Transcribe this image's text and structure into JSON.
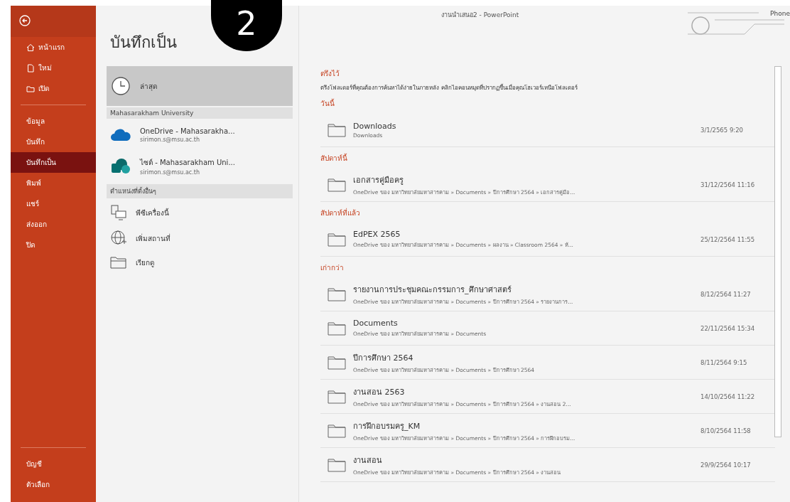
{
  "window": {
    "title": "งานนำเสนอ2 - PowerPoint",
    "user": "Phone"
  },
  "annotation": {
    "label": "2"
  },
  "sidebar": {
    "items": [
      {
        "label": "หน้าแรก",
        "kind": "home",
        "selected": false
      },
      {
        "label": "ใหม่",
        "kind": "new",
        "selected": false
      },
      {
        "label": "เปิด",
        "kind": "open",
        "selected": false
      },
      {
        "label": "ข้อมูล",
        "kind": "plain",
        "selected": false
      },
      {
        "label": "บันทึก",
        "kind": "plain",
        "selected": false
      },
      {
        "label": "บันทึกเป็น",
        "kind": "plain",
        "selected": true
      },
      {
        "label": "พิมพ์",
        "kind": "plain",
        "selected": false
      },
      {
        "label": "แชร์",
        "kind": "plain",
        "selected": false
      },
      {
        "label": "ส่งออก",
        "kind": "plain",
        "selected": false
      },
      {
        "label": "ปิด",
        "kind": "plain",
        "selected": false
      }
    ],
    "bottom_items": [
      {
        "label": "บัญชี"
      },
      {
        "label": "ตัวเลือก"
      }
    ]
  },
  "heading": "บันทึกเป็น",
  "locations": [
    {
      "kind": "recent",
      "label": "ล่าสุด",
      "selected": true
    },
    {
      "kind": "group",
      "label": "Mahasarakham University"
    },
    {
      "kind": "onedrive",
      "label": "OneDrive - Mahasarakha...",
      "sub": "sirimon.s@msu.ac.th",
      "selected": false
    },
    {
      "kind": "sites",
      "label": "ไซต์ - Mahasarakham Uni...",
      "sub": "sirimon.s@msu.ac.th",
      "selected": false
    },
    {
      "kind": "group",
      "label": "ตำแหน่งที่ตั้งอื่นๆ"
    },
    {
      "kind": "pc",
      "label": "พีซีเครื่องนี้",
      "selected": false
    },
    {
      "kind": "add",
      "label": "เพิ่มสถานที่",
      "selected": false
    },
    {
      "kind": "browse",
      "label": "เรียกดู",
      "selected": false
    }
  ],
  "pinned": {
    "title": "ตรึงไว้",
    "hint": "ตรึงโฟลเดอร์ที่คุณต้องการค้นหาได้ง่ายในภายหลัง คลิกไอคอนหมุดที่ปรากฏขึ้นเมื่อคุณโฮเวอร์เหนือโฟลเดอร์"
  },
  "sections": [
    {
      "title": "วันนี้",
      "rows": [
        {
          "name": "Downloads",
          "path": "Downloads",
          "date": "3/1/2565 9:20"
        }
      ]
    },
    {
      "title": "สัปดาห์นี้",
      "rows": [
        {
          "name": "เอกสารคู่มือครู",
          "path": "OneDrive ของ มหาวิทยาลัยมหาสารคาม » Documents » ปีการศึกษา 2564 » เอกสารคู่มือ...",
          "date": "31/12/2564 11:16"
        }
      ]
    },
    {
      "title": "สัปดาห์ที่แล้ว",
      "rows": [
        {
          "name": "EdPEX 2565",
          "path": "OneDrive ของ มหาวิทยาลัยมหาสารคาม » Documents » ผลงาน » Classroom 2564 » ห้...",
          "date": "25/12/2564 11:55"
        }
      ]
    },
    {
      "title": "เก่ากว่า",
      "rows": [
        {
          "name": "รายงานการประชุมคณะกรรมการ_ศึกษาศาสตร์",
          "path": "OneDrive ของ มหาวิทยาลัยมหาสารคาม » Documents » ปีการศึกษา 2564 » รายงานการ...",
          "date": "8/12/2564 11:27"
        },
        {
          "name": "Documents",
          "path": "OneDrive ของ มหาวิทยาลัยมหาสารคาม » Documents",
          "date": "22/11/2564 15:34"
        },
        {
          "name": "ปีการศึกษา 2564",
          "path": "OneDrive ของ มหาวิทยาลัยมหาสารคาม » Documents » ปีการศึกษา 2564",
          "date": "8/11/2564 9:15"
        },
        {
          "name": "งานสอน 2563",
          "path": "OneDrive ของ มหาวิทยาลัยมหาสารคาม » Documents » ปีการศึกษา 2564 » งานสอน 2...",
          "date": "14/10/2564 11:22"
        },
        {
          "name": "การฝึกอบรมครู_KM",
          "path": "OneDrive ของ มหาวิทยาลัยมหาสารคาม » Documents » ปีการศึกษา 2564 » การฝึกอบรม...",
          "date": "8/10/2564 11:58"
        },
        {
          "name": "งานสอน",
          "path": "OneDrive ของ มหาวิทยาลัยมหาสารคาม » Documents » ปีการศึกษา 2564 » งานสอน",
          "date": "29/9/2564 10:17"
        }
      ]
    }
  ]
}
